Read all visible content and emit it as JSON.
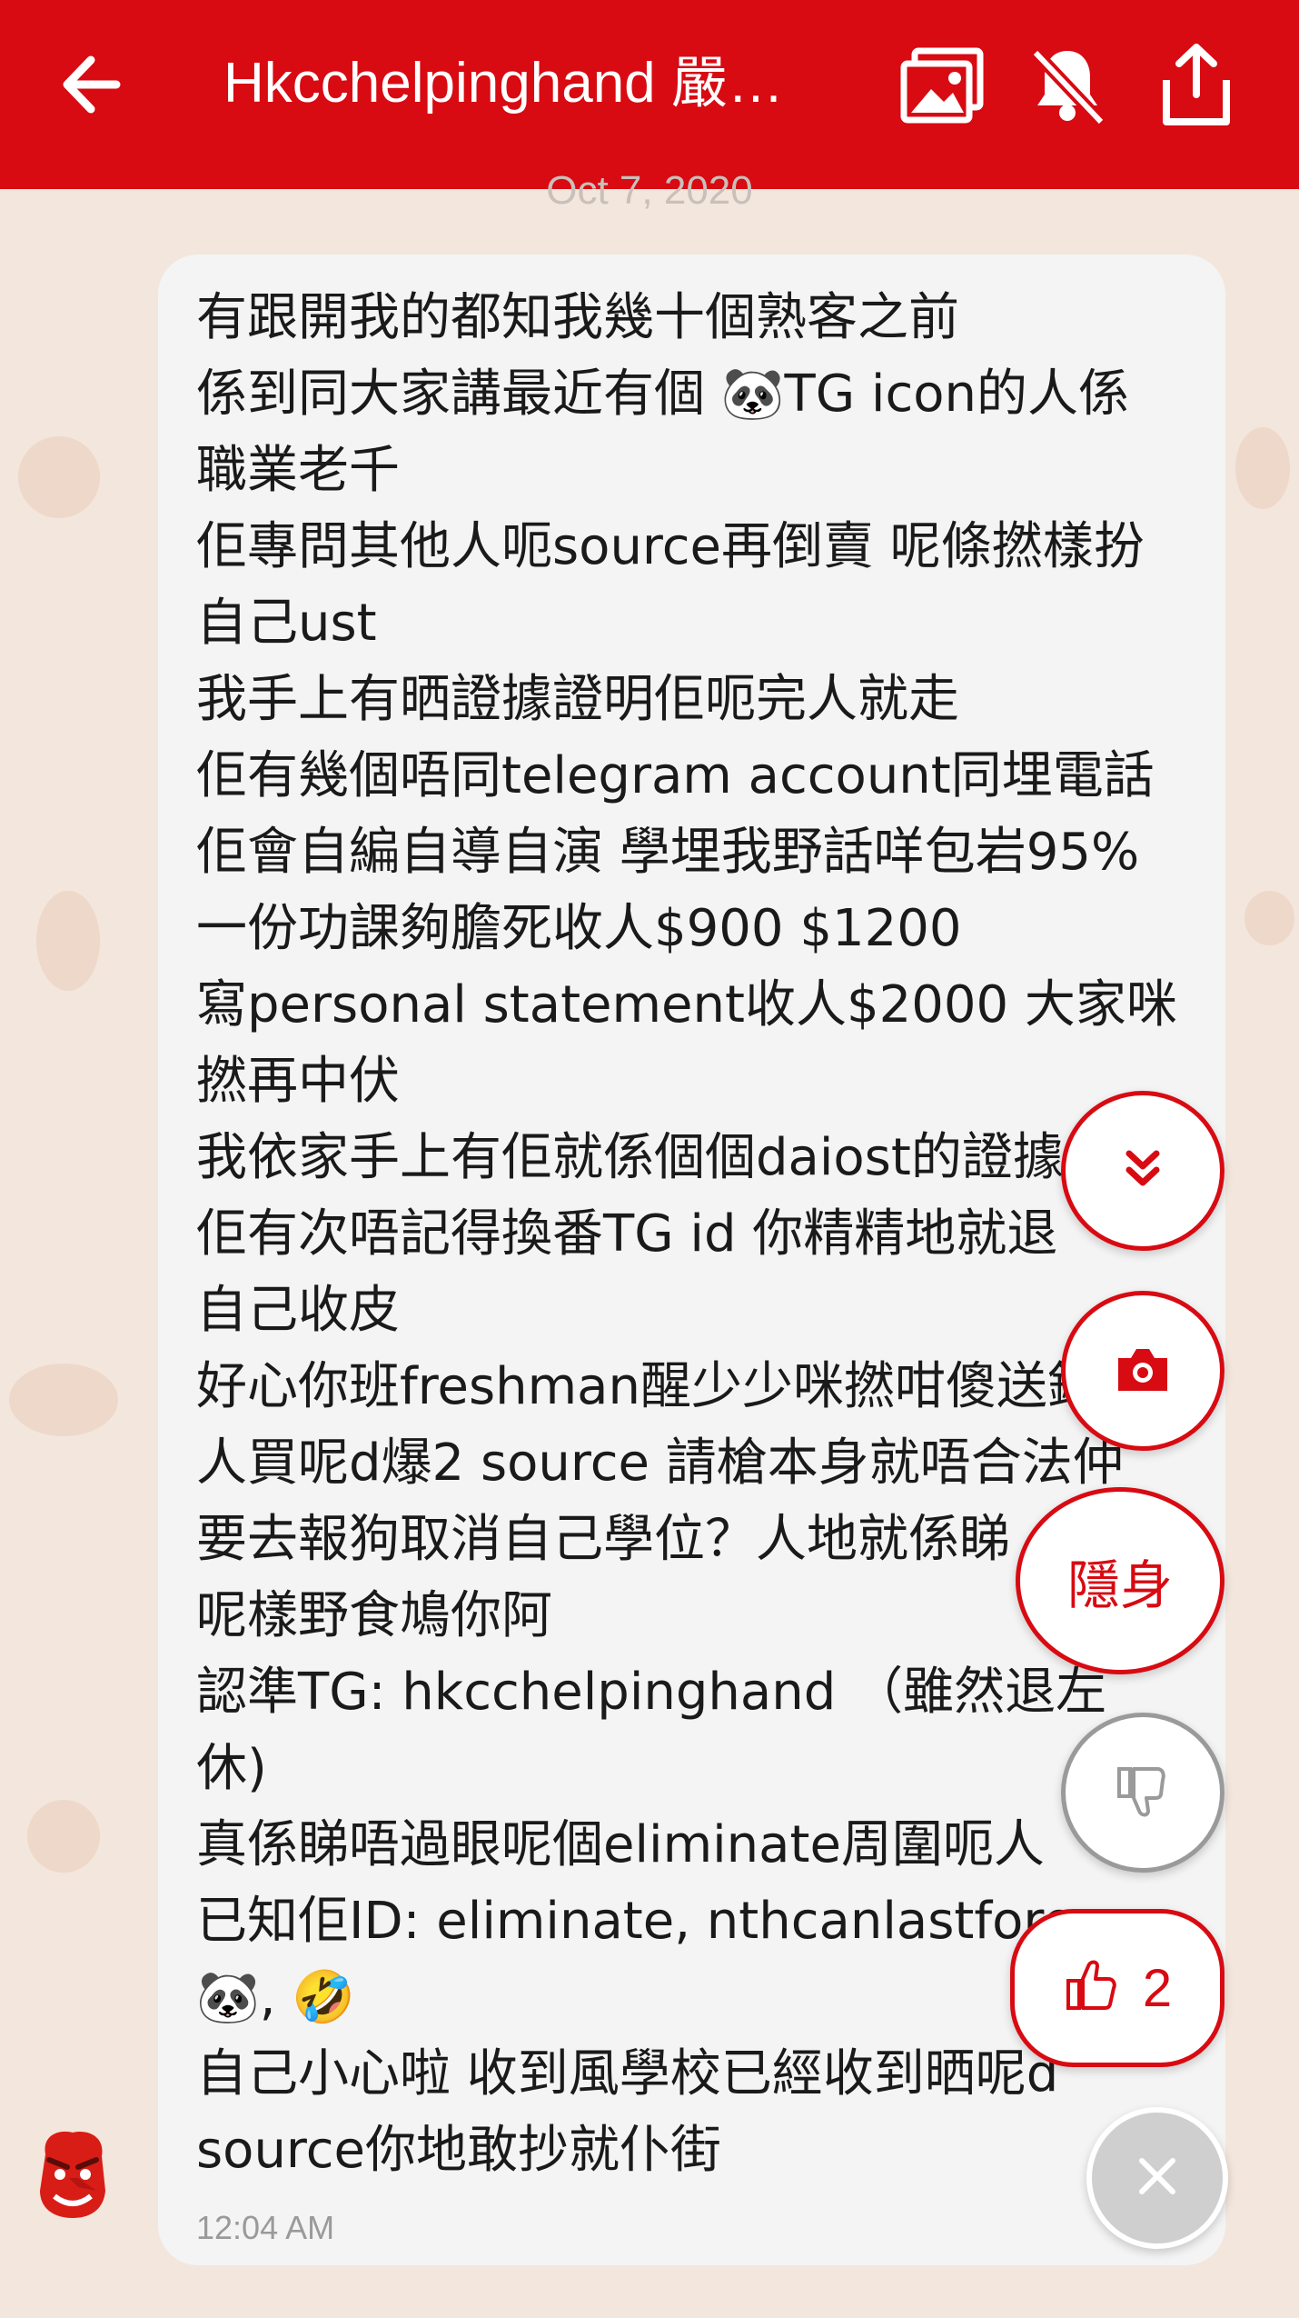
{
  "header": {
    "title": "Hkcchelpinghand 嚴…",
    "back_icon": "arrow-left-icon",
    "actions": [
      "gallery-icon",
      "bell-off-icon",
      "share-icon"
    ],
    "background": "#d80a12"
  },
  "date_separator": "Oct 7, 2020",
  "message": {
    "lines": [
      "有跟開我的都知我幾十個熟客之前",
      "係到同大家講最近有個 🐼TG icon的人係",
      "職業老千",
      "佢專問其他人呃source再倒賣 呢條撚樣扮",
      "自己ust",
      "我手上有晒證據證明佢呃完人就走",
      "佢有幾個唔同telegram account同埋電話",
      "佢會自編自導自演 學埋我野話咩包岩95%",
      "一份功課夠膽死收人$900 $1200",
      "寫personal statement收人$2000 大家咪",
      "撚再中伏",
      "我依家手上有佢就係個個daiost的證據",
      "佢有次唔記得換番TG id 你精精地就退",
      "自己收皮",
      "好心你班freshman醒少少咪撚咁傻送錢",
      "人買呢d爆2 source 請槍本身就唔合法仲",
      "要去報狗取消自己學位？人地就係睇",
      "呢樣野食鳩你阿",
      "認準TG: hkcchelpinghand （雖然退左",
      "休)",
      "真係睇唔過眼呢個eliminate周圍呃人",
      "已知佢ID: eliminate, nthcanlastforever",
      "🐼, 🤣",
      "自己小心啦 收到風學校已經收到晒呢d",
      "source你地敢抄就仆街"
    ],
    "time": "12:04 AM"
  },
  "fabs": {
    "scroll_down_icon": "double-chevron-down-icon",
    "camera_icon": "camera-icon",
    "hide_label": "隱身",
    "dislike_icon": "thumbs-down-icon",
    "like_icon": "thumbs-up-icon",
    "like_count": "2",
    "close_icon": "close-icon"
  }
}
